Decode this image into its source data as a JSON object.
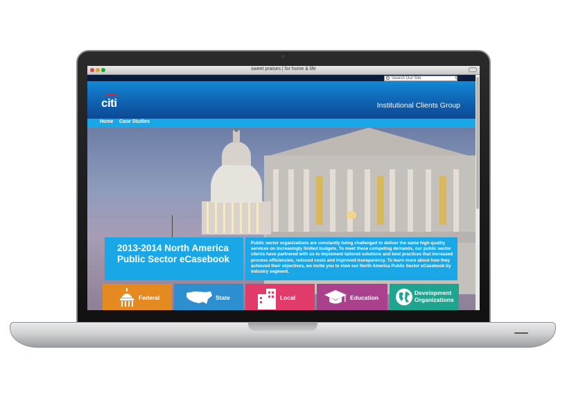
{
  "browser": {
    "title": "sweet praises | for home & life"
  },
  "site": {
    "search_placeholder": "Search Our Site",
    "search_go": "GO",
    "logo": "citi",
    "group_name": "Institutional Clients Group",
    "nav": [
      "Home",
      "Case Studies"
    ]
  },
  "hero": {
    "title_line1": "2013-2014 North America",
    "title_line2": "Public Sector eCasebook",
    "description": "Public sector organizations are constantly being challenged to deliver the same high-quality services on increasingly limited budgets. To meet these competing demands, our public sector clients have partnered with us to implement tailored solutions and best practices that increased process efficiencies, reduced costs and improved transparency. To learn more about how they achieved their objectives, we invite you to view our North America Public Sector eCasebook by industry segment."
  },
  "categories": [
    {
      "label": "Federal",
      "icon": "capitol-icon",
      "color": "#e58a21"
    },
    {
      "label": "State",
      "icon": "usa-map-icon",
      "color": "#2d8fd0"
    },
    {
      "label": "Local",
      "icon": "city-building-icon",
      "color": "#e13b6c"
    },
    {
      "label": "Education",
      "icon": "graduation-cap-icon",
      "color": "#a9418d"
    },
    {
      "label": "Development Organizations",
      "icon": "globe-icon",
      "color": "#1fa58f"
    }
  ],
  "colors": {
    "header_blue": "#0f5fae",
    "nav_blue": "#1aa7e8",
    "citi_red": "#e3262e"
  }
}
